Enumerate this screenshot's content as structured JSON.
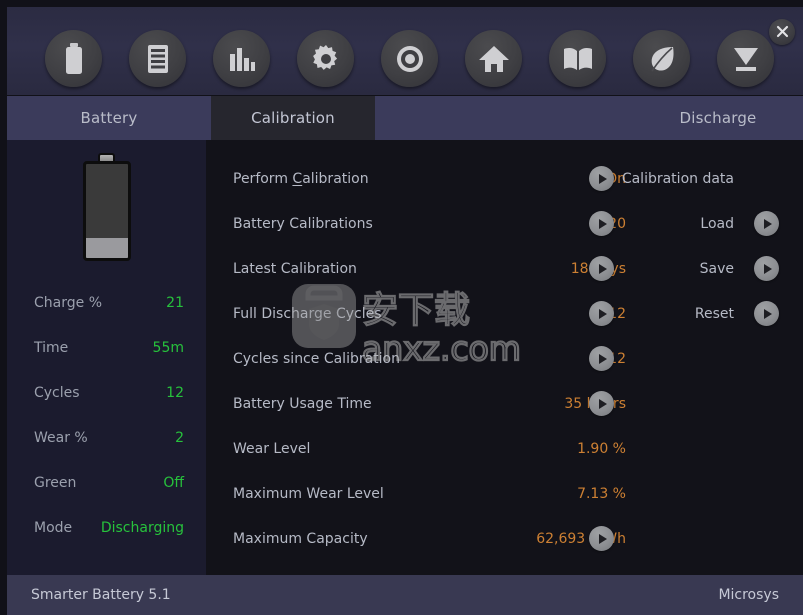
{
  "app": {
    "name": "Smarter Battery 5.1",
    "vendor": "Microsys"
  },
  "toolbar": {
    "buttons": [
      {
        "icon": "battery-icon",
        "name": "battery"
      },
      {
        "icon": "list-icon",
        "name": "details"
      },
      {
        "icon": "bar-chart-icon",
        "name": "statistics"
      },
      {
        "icon": "gear-icon",
        "name": "settings"
      },
      {
        "icon": "target-icon",
        "name": "calibration"
      },
      {
        "icon": "home-icon",
        "name": "home"
      },
      {
        "icon": "book-icon",
        "name": "help"
      },
      {
        "icon": "leaf-icon",
        "name": "green-mode"
      },
      {
        "icon": "discharge-icon",
        "name": "discharge"
      }
    ],
    "close_label": "×"
  },
  "tabs": [
    {
      "label": "Battery",
      "active": false
    },
    {
      "label": "Calibration",
      "active": true
    },
    {
      "label": "Discharge",
      "active": false
    }
  ],
  "sidebar": {
    "battery": {
      "charge_percent": 21
    },
    "stats": [
      {
        "label": "Charge %",
        "value": "21"
      },
      {
        "label": "Time",
        "value": "55m"
      },
      {
        "label": "Cycles",
        "value": "12"
      },
      {
        "label": "Wear %",
        "value": "2"
      },
      {
        "label": "Green",
        "value": "Off"
      },
      {
        "label": "Mode",
        "value": "Discharging"
      }
    ]
  },
  "main": {
    "rows": [
      {
        "label_pre": "Perform ",
        "label_key": "C",
        "label_post": "alibration",
        "label": "Perform Calibration",
        "value": "On",
        "has_play": true
      },
      {
        "label": "Battery Calibrations",
        "value": "20",
        "has_play": true
      },
      {
        "label": "Latest Calibration",
        "value": "18 days",
        "has_play": true
      },
      {
        "label": "Full Discharge Cycles",
        "value": "12",
        "has_play": true
      },
      {
        "label": "Cycles since Calibration",
        "value": "12",
        "has_play": true
      },
      {
        "label": "Battery Usage Time",
        "value": "35 hours",
        "has_play": true
      },
      {
        "label": "Wear Level",
        "value": "1.90 %",
        "has_play": false
      },
      {
        "label": "Maximum Wear Level",
        "value": "7.13 %",
        "has_play": false
      },
      {
        "label": "Maximum Capacity",
        "value": "62,693 mWh",
        "has_play": true
      }
    ]
  },
  "actions": {
    "title": "Calibration data",
    "items": [
      {
        "label": "Load"
      },
      {
        "label": "Save"
      },
      {
        "label": "Reset"
      }
    ]
  },
  "watermark": {
    "text_cn": "安下载",
    "text_url": "anxz.com"
  },
  "colors": {
    "toolbar_bg": "#2e2e47",
    "tab_bar_bg": "#3b3b5b",
    "tab_active_bg": "#26262e",
    "sidebar_bg": "#1b1b2e",
    "main_bg": "#121219",
    "statusbar_bg": "#393952",
    "value_green": "#27c23c",
    "value_orange": "#cd8033",
    "label_gray": "#b6bac6"
  }
}
